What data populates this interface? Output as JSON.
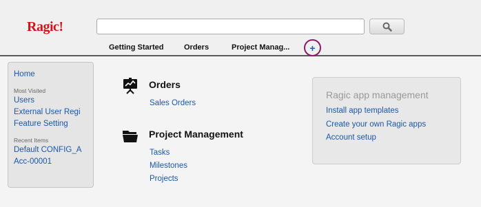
{
  "header": {
    "logo": "Ragic!",
    "search": {
      "value": "",
      "placeholder": ""
    },
    "tabs": [
      {
        "label": "Getting Started"
      },
      {
        "label": "Orders"
      },
      {
        "label": "Project Manag..."
      }
    ],
    "add_tab_label": "+",
    "icons": {
      "search": "magnifier-icon",
      "add": "plus-icon"
    },
    "colors": {
      "logo": "#d4141c",
      "add_tab_ring": "#8b1a6b",
      "link": "#1a57a8"
    }
  },
  "sidebar": {
    "home": "Home",
    "most_visited_heading": "Most Visited",
    "most_visited": [
      "Users",
      "External User Regi",
      "Feature Setting"
    ],
    "recent_heading": "Recent Items",
    "recent": [
      "Default CONFIG_A",
      "Acc-00001"
    ]
  },
  "main": {
    "sections": [
      {
        "title": "Orders",
        "icon": "presentation-board-icon",
        "links": [
          "Sales Orders"
        ]
      },
      {
        "title": "Project Management",
        "icon": "folder-icon",
        "links": [
          "Tasks",
          "Milestones",
          "Projects"
        ]
      }
    ]
  },
  "management": {
    "title": "Ragic app management",
    "links": [
      "Install app templates",
      "Create your own Ragic apps",
      "Account setup"
    ]
  }
}
